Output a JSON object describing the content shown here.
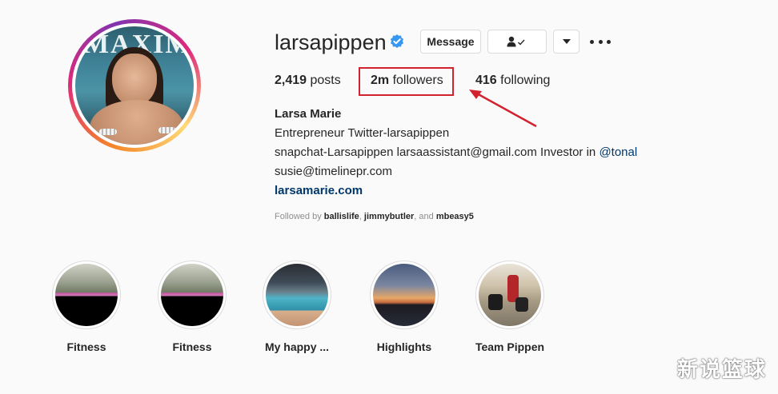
{
  "profile": {
    "username": "larsapippen",
    "verified_icon": "verified-badge-icon",
    "avatar_magazine_text": "MAXIM"
  },
  "actions": {
    "message_label": "Message",
    "following_icon": "person-check-icon",
    "dropdown_icon": "chevron-down-icon",
    "more_icon": "more-options-icon"
  },
  "stats": {
    "posts_count": "2,419",
    "posts_label": "posts",
    "followers_count": "2m",
    "followers_label": "followers",
    "following_count": "416",
    "following_label": "following"
  },
  "annotation": {
    "color": "#d2222d"
  },
  "bio": {
    "name": "Larsa Marie",
    "line1": "Entrepreneur Twitter-larsapippen",
    "line2_text": "snapchat-Larsapippen larsaassistant@gmail.com Investor in ",
    "line2_mention": "@tonal",
    "line3": "susie@timelinepr.com",
    "link": "larsamarie.com"
  },
  "followed_by": {
    "prefix": "Followed by ",
    "user1": "ballislife",
    "sep1": ", ",
    "user2": "jimmybutler",
    "sep2": ", and ",
    "user3": "mbeasy5"
  },
  "highlights": [
    {
      "label": "Fitness"
    },
    {
      "label": "Fitness"
    },
    {
      "label": "My happy ..."
    },
    {
      "label": "Highlights"
    },
    {
      "label": "Team Pippen"
    }
  ],
  "watermark": "新说篮球",
  "colors": {
    "link": "#00376b",
    "verified": "#3897f0",
    "background": "#fafafa"
  }
}
